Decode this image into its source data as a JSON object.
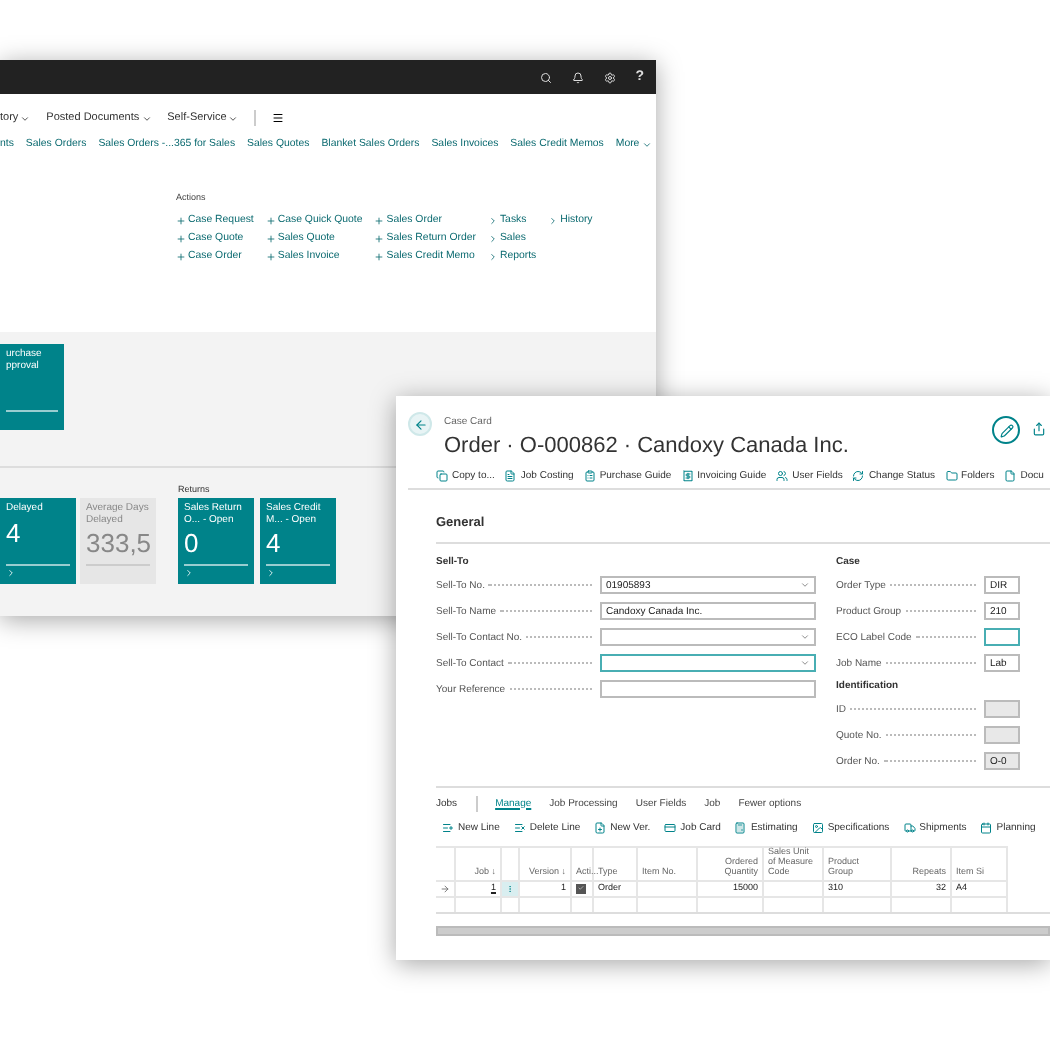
{
  "back_window": {
    "top_bar": {
      "help": "?"
    },
    "nav": [
      {
        "label": "tory",
        "dropdown": true
      },
      {
        "label": "Posted Documents",
        "dropdown": true
      },
      {
        "label": "Self-Service",
        "dropdown": true
      }
    ],
    "links": [
      "nts",
      "Sales Orders",
      "Sales Orders -...365 for Sales",
      "Sales Quotes",
      "Blanket Sales Orders",
      "Sales Invoices",
      "Sales Credit Memos",
      "More"
    ],
    "actions": {
      "title": "Actions",
      "columns": [
        [
          {
            "kind": "add",
            "label": "Case Request"
          },
          {
            "kind": "add",
            "label": "Case Quote"
          },
          {
            "kind": "add",
            "label": "Case Order"
          }
        ],
        [
          {
            "kind": "add",
            "label": "Case Quick Quote"
          },
          {
            "kind": "add",
            "label": "Sales Quote"
          },
          {
            "kind": "add",
            "label": "Sales Invoice"
          }
        ],
        [
          {
            "kind": "add",
            "label": "Sales Order"
          },
          {
            "kind": "add",
            "label": "Sales Return Order"
          },
          {
            "kind": "add",
            "label": "Sales Credit Memo"
          }
        ],
        [
          {
            "kind": "group",
            "label": "Tasks"
          },
          {
            "kind": "group",
            "label": "Sales"
          },
          {
            "kind": "group",
            "label": "Reports"
          }
        ],
        [
          {
            "kind": "group",
            "label": "History"
          }
        ]
      ]
    },
    "approval_tile": {
      "lines": [
        "urchase",
        "pproval"
      ]
    },
    "tiles": [
      {
        "label": "Delayed",
        "value": "4",
        "kind": "teal"
      },
      {
        "label": "Average Days Delayed",
        "value": "333,5",
        "kind": "grey"
      }
    ],
    "returns": {
      "title": "Returns",
      "tiles": [
        {
          "label": "Sales Return O... - Open",
          "value": "0",
          "kind": "teal"
        },
        {
          "label": "Sales Credit M... - Open",
          "value": "4",
          "kind": "teal"
        }
      ]
    }
  },
  "front_window": {
    "caption": "Case Card",
    "title": "Order · O-000862 · Candoxy Canada Inc.",
    "actions": [
      "Copy to...",
      "Job Costing",
      "Purchase Guide",
      "Invoicing Guide",
      "User Fields",
      "Change Status",
      "Folders",
      "Docu"
    ],
    "section": "General",
    "sell_to": {
      "title": "Sell-To",
      "fields": [
        {
          "label": "Sell-To No.",
          "value": "01905893",
          "dropdown": true,
          "focused": false
        },
        {
          "label": "Sell-To Name",
          "value": "Candoxy Canada Inc.",
          "dropdown": false,
          "focused": false
        },
        {
          "label": "Sell-To Contact No.",
          "dropdown": true,
          "focused": false
        },
        {
          "label": "Sell-To Contact",
          "dropdown": true,
          "focused": true
        },
        {
          "label": "Your Reference",
          "dropdown": false,
          "focused": false
        }
      ]
    },
    "case": {
      "title": "Case",
      "fields": [
        {
          "label": "Order Type",
          "value": "DIR",
          "readonly": false,
          "focused": false
        },
        {
          "label": "Product Group",
          "value": "210",
          "readonly": false,
          "focused": false
        },
        {
          "label": "ECO Label Code",
          "readonly": false,
          "focused": true
        },
        {
          "label": "Job Name",
          "value": "Lab",
          "readonly": false,
          "focused": false
        }
      ]
    },
    "identification": {
      "title": "Identification",
      "fields": [
        {
          "label": "ID",
          "readonly": true,
          "focused": false
        },
        {
          "label": "Quote No.",
          "readonly": true,
          "focused": false
        },
        {
          "label": "Order No.",
          "value": "O-0",
          "readonly": true,
          "focused": false
        }
      ]
    },
    "jobs": {
      "title": "Jobs",
      "tabs": [
        {
          "label": "Manage",
          "selected": true
        },
        {
          "label": "Job Processing",
          "selected": false
        },
        {
          "label": "User Fields",
          "selected": false
        },
        {
          "label": "Job",
          "selected": false
        },
        {
          "label": "Fewer options",
          "selected": false
        }
      ],
      "actions": [
        "New Line",
        "Delete Line",
        "New Ver.",
        "Job Card",
        "Estimating",
        "Specifications",
        "Shipments",
        "Planning"
      ],
      "columns": [
        "Job ↓",
        "",
        "Version ↓",
        "Acti...",
        "Type",
        "Item No.",
        "Ordered Quantity",
        "Sales Unit of Measure Code",
        "Product Group",
        "Repeats",
        "Item Si"
      ],
      "rows": [
        {
          "job": "1",
          "version": "1",
          "active": true,
          "type": "Order",
          "item_no": "",
          "ordered_quantity": "15000",
          "unit": "",
          "product_group": "310",
          "repeats": "32",
          "item_size": "A4"
        }
      ]
    }
  }
}
